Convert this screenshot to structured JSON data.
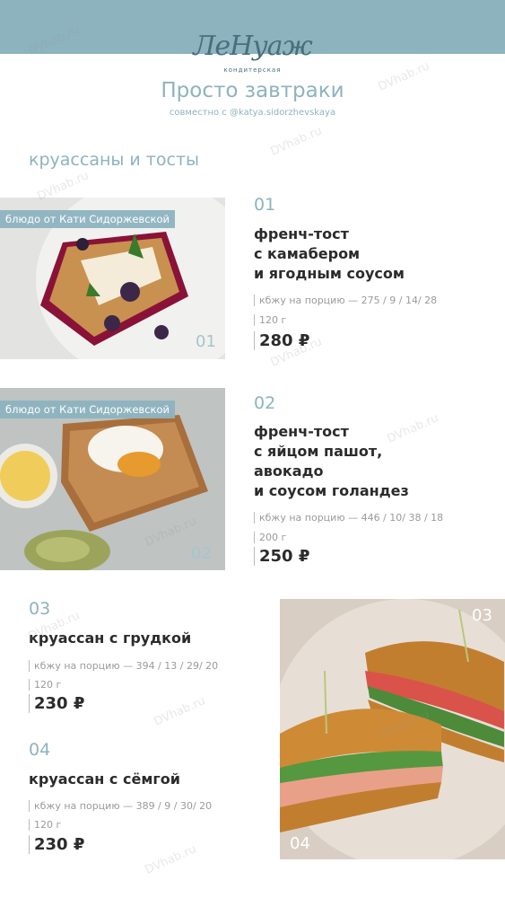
{
  "header": {
    "logo_text": "ЛеНуаж",
    "logo_sub": "кондитерская",
    "title": "Просто завтраки",
    "subtitle": "совместно с @katya.sidorzhevskaya"
  },
  "section_title": "круассаны и тосты",
  "watermark": "DVhab.ru",
  "items": [
    {
      "num": "01",
      "badge": "блюдо от Кати Сидоржевской",
      "photo_num": "01",
      "name_lines": [
        "френч-тост",
        "с камабером",
        "и ягодным соусом"
      ],
      "kbju": "кбжу на порцию — 275 / 9 / 14/ 28",
      "weight": "120 г",
      "price": "280 ₽"
    },
    {
      "num": "02",
      "badge": "блюдо от Кати Сидоржевской",
      "photo_num": "02",
      "name_lines": [
        "френч-тост",
        "с яйцом пашот,",
        "авокадо",
        "и соусом голандез"
      ],
      "kbju": "кбжу на порцию — 446 / 10/ 38 / 18",
      "weight": "200 г",
      "price": "250 ₽"
    },
    {
      "num": "03",
      "photo_num": "03",
      "name_lines": [
        "круассан с грудкой"
      ],
      "kbju": "кбжу на порцию — 394 / 13 / 29/ 20",
      "weight": "120 г",
      "price": "230 ₽"
    },
    {
      "num": "04",
      "photo_num": "04",
      "name_lines": [
        "круассан с сёмгой"
      ],
      "kbju": "кбжу на порцию — 389 / 9 / 30/ 20",
      "weight": "120 г",
      "price": "230 ₽"
    }
  ],
  "colors": {
    "accent": "#8db3bf",
    "text": "#2b2b2b",
    "muted": "#9a9a9a"
  }
}
